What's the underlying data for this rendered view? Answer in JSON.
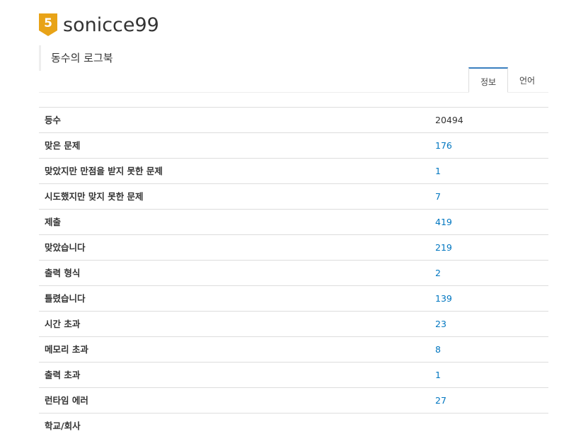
{
  "profile": {
    "username": "sonicce99",
    "tier_number": "5",
    "tier_color": "#e8a317",
    "bio": "동수의 로그북"
  },
  "tabs": [
    {
      "label": "정보",
      "active": true
    },
    {
      "label": "언어",
      "active": false
    }
  ],
  "stats": {
    "rank_label": "등수",
    "rank_value": "20494",
    "solved_label": "맞은 문제",
    "solved_value": "176",
    "partial_label": "맞았지만 만점을 받지 못한 문제",
    "partial_value": "1",
    "failed_label": "시도했지만 맞지 못한 문제",
    "failed_value": "7",
    "submissions_label": "제출",
    "submissions_value": "419",
    "accepted_label": "맞았습니다",
    "accepted_value": "219",
    "output_format_label": "출력 형식",
    "output_format_value": "2",
    "wrong_label": "틀렸습니다",
    "wrong_value": "139",
    "tle_label": "시간 초과",
    "tle_value": "23",
    "mle_label": "메모리 초과",
    "mle_value": "8",
    "ole_label": "출력 초과",
    "ole_value": "1",
    "rte_label": "런타임 에러",
    "rte_value": "27",
    "school_label": "학교/회사"
  },
  "colors": {
    "link": "#0076c0",
    "tab_active_border": "#3a7fbf"
  }
}
